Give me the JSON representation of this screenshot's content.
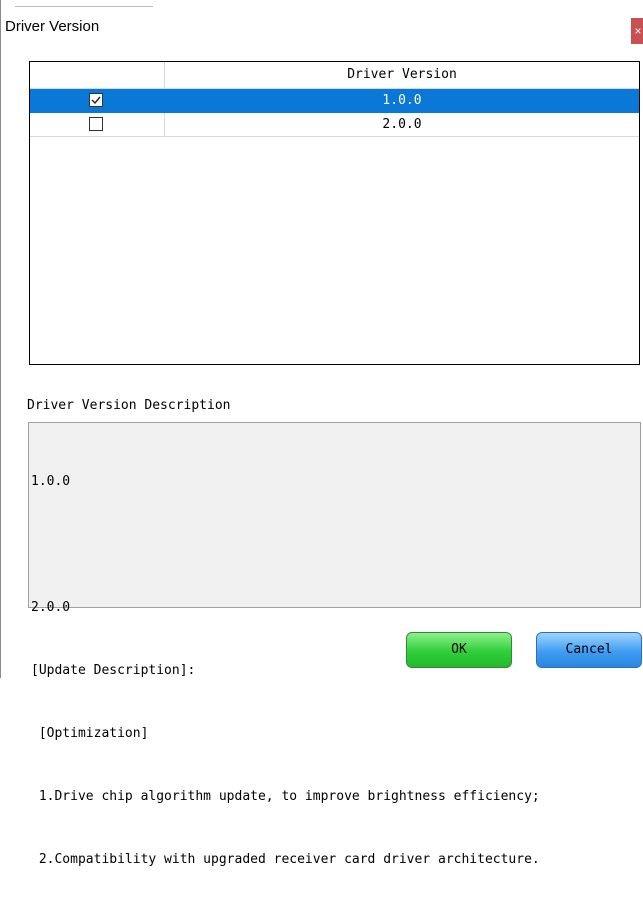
{
  "window": {
    "title": "Driver Version",
    "close_glyph": "×"
  },
  "table": {
    "column_header": "Driver Version",
    "rows": [
      {
        "version": "1.0.0",
        "checked": true,
        "selected": true
      },
      {
        "version": "2.0.0",
        "checked": false,
        "selected": false
      }
    ]
  },
  "description": {
    "label": "Driver Version Description",
    "lines": [
      "1.0.0",
      "",
      "2.0.0",
      "[Update Description]:",
      " [Optimization]",
      " 1.Drive chip algorithm update, to improve brightness efficiency;",
      " 2.Compatibility with upgraded receiver card driver architecture."
    ]
  },
  "buttons": {
    "ok": "OK",
    "cancel": "Cancel"
  },
  "colors": {
    "selection": "#0a78d7",
    "ok_button": "#2fcf3a",
    "cancel_button": "#3f9cf2",
    "close_button": "#c75050"
  }
}
